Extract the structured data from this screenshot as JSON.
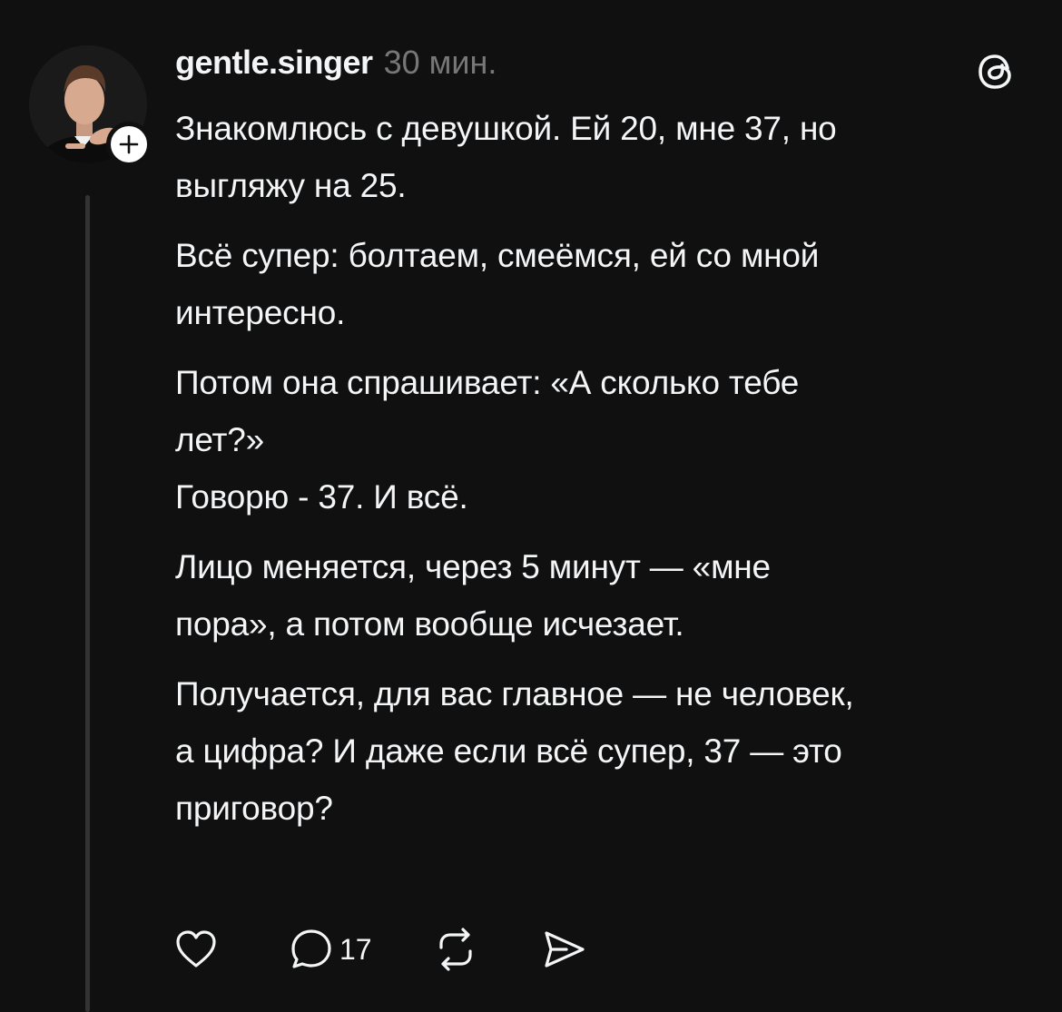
{
  "post": {
    "username": "gentle.singer",
    "time": "30 мин.",
    "paragraphs": [
      "Знакомлюсь с девушкой. Ей 20, мне 37, но\nвыгляжу на 25.",
      "Всё супер: болтаем, смеёмся, ей со мной\nинтересно.",
      "Потом она спрашивает: «А сколько тебе\nлет?»\nГоворю - 37. И всё.",
      "Лицо меняется, через 5 минут — «мне\nпора», а потом вообще исчезает.",
      "Получается, для вас главное — не человек,\nа цифра? И даже если всё супер, 37 — это\nприговор?"
    ]
  },
  "actions": {
    "like_icon": "heart-icon",
    "reply_icon": "comment-bubble-icon",
    "reply_count": "17",
    "repost_icon": "repost-icon",
    "share_icon": "send-icon"
  },
  "colors": {
    "background": "#101010",
    "text": "#f3f5f7",
    "muted": "#777777",
    "thread_line": "#333333"
  }
}
